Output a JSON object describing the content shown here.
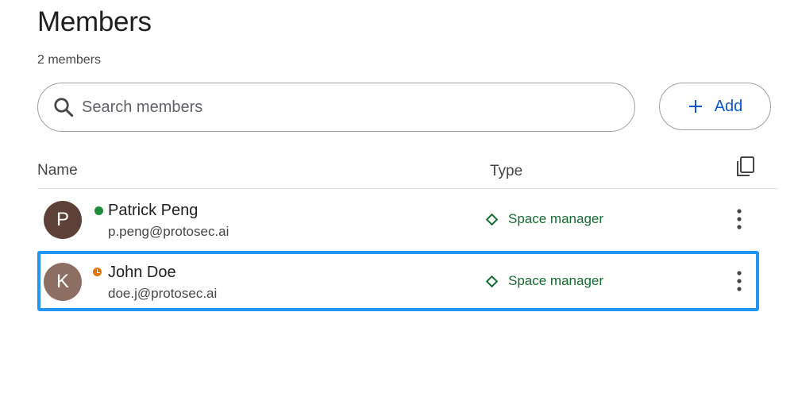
{
  "header": {
    "title": "Members",
    "member_count": "2 members"
  },
  "search": {
    "placeholder": "Search members",
    "value": "",
    "icon": "search-icon"
  },
  "add_button": {
    "label": "Add",
    "icon": "plus-icon"
  },
  "table": {
    "columns": [
      "Name",
      "Type"
    ],
    "copy_icon": "copy-icon",
    "rows": [
      {
        "initial": "P",
        "avatar_color": "#5d4037",
        "status": "online",
        "name": "Patrick Peng",
        "email": "p.peng@protosec.ai",
        "type": "Space manager",
        "selected": false
      },
      {
        "initial": "K",
        "avatar_color": "#8d6e63",
        "status": "away",
        "name": "John Doe",
        "email": "doe.j@protosec.ai",
        "type": "Space manager",
        "selected": true
      }
    ]
  },
  "colors": {
    "accent": "#0b57d0",
    "type_green": "#146c2e",
    "online": "#1e8e3e",
    "away": "#e37400",
    "selection": "#2196f3"
  }
}
